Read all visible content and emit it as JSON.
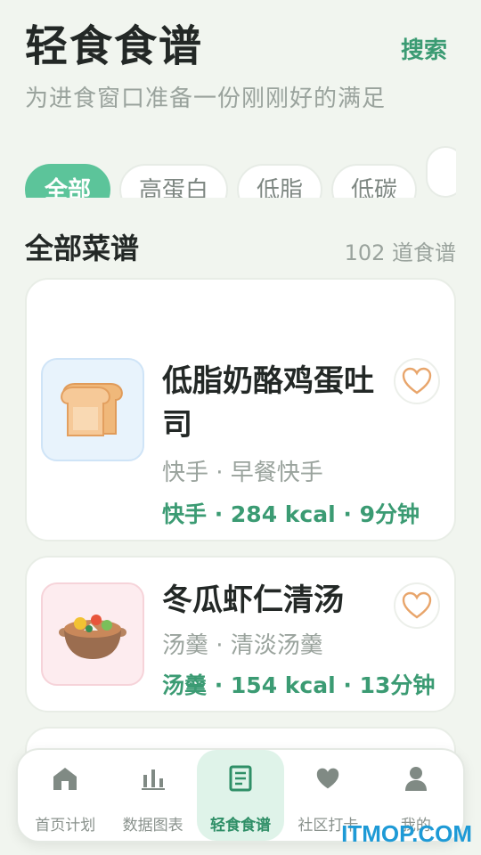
{
  "header": {
    "title": "轻食食谱",
    "search_label": "搜索",
    "subtitle": "为进食窗口准备一份刚刚好的满足"
  },
  "filters": [
    {
      "label": "全部",
      "active": true
    },
    {
      "label": "高蛋白",
      "active": false
    },
    {
      "label": "低脂",
      "active": false
    },
    {
      "label": "低碳",
      "active": false
    },
    {
      "label": "",
      "active": false
    }
  ],
  "section": {
    "title": "全部菜谱",
    "count": "102 道食谱"
  },
  "recipes": [
    {
      "title": "低脂奶酪鸡蛋吐司",
      "tags": "快手 · 早餐快手",
      "meta": "快手 · 284 kcal · 9分钟",
      "icon": "toast-icon"
    },
    {
      "title": "冬瓜虾仁清汤",
      "tags": "汤羹 · 清淡汤羹",
      "meta": "汤羹 · 154 kcal · 13分钟",
      "icon": "soup-pot-icon"
    }
  ],
  "tabs": [
    {
      "label": "首页计划",
      "icon": "home-icon",
      "active": false
    },
    {
      "label": "数据图表",
      "icon": "bar-chart-icon",
      "active": false
    },
    {
      "label": "轻食食谱",
      "icon": "recipe-book-icon",
      "active": true
    },
    {
      "label": "社区打卡",
      "icon": "heart-icon",
      "active": false
    },
    {
      "label": "我的",
      "icon": "user-icon",
      "active": false
    }
  ],
  "watermark": "ITMOP.COM",
  "colors": {
    "accent": "#3b9b73",
    "chip_active": "#5cc49a",
    "background": "#f1f5ef"
  }
}
